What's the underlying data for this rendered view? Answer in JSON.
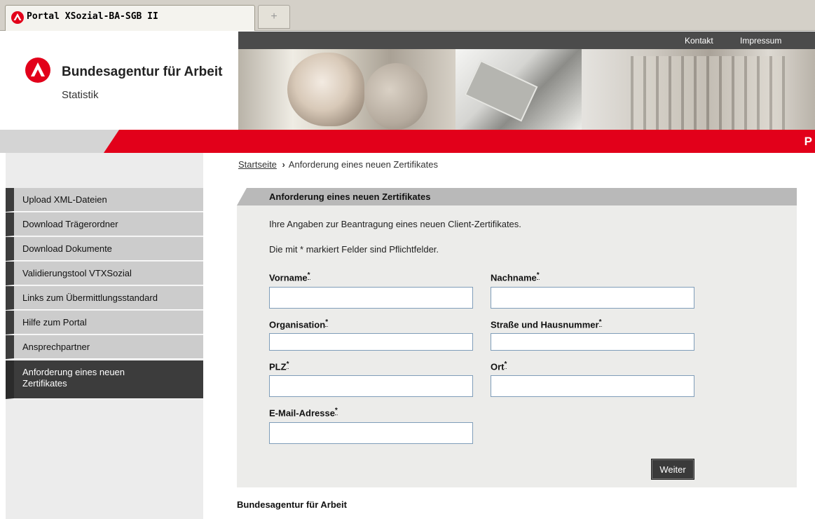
{
  "browser": {
    "tab_title": "Portal XSozial-BA-SGB II",
    "new_tab_symbol": "+"
  },
  "header": {
    "org_name": "Bundesagentur für Arbeit",
    "org_sub": "Statistik",
    "topnav": [
      "Kontakt",
      "Impressum"
    ],
    "redband_letter": "P"
  },
  "sidebar": {
    "items": [
      {
        "label": "Upload XML-Dateien"
      },
      {
        "label": "Download Trägerordner"
      },
      {
        "label": "Download Dokumente"
      },
      {
        "label": "Validierungstool VTXSozial"
      },
      {
        "label": "Links zum Übermittlungsstandard"
      },
      {
        "label": "Hilfe zum Portal"
      },
      {
        "label": "Ansprechpartner"
      },
      {
        "label": "Anforderung eines neuen Zertifikates",
        "active": true
      }
    ]
  },
  "breadcrumb": {
    "home": "Startseite",
    "separator": "›",
    "current": "Anforderung eines neuen Zertifikates"
  },
  "form": {
    "title": "Anforderung eines neuen Zertifikates",
    "intro": "Ihre Angaben zur Beantragung eines neuen Client-Zertifikates.",
    "required_note": "Die mit * markiert Felder sind Pflichtfelder.",
    "required_marker": "*",
    "fields": {
      "vorname": {
        "label": "Vorname",
        "value": ""
      },
      "nachname": {
        "label": "Nachname",
        "value": ""
      },
      "organisation": {
        "label": "Organisation",
        "value": ""
      },
      "strasse": {
        "label": "Straße und Hausnummer",
        "value": ""
      },
      "plz": {
        "label": "PLZ",
        "value": ""
      },
      "ort": {
        "label": "Ort",
        "value": ""
      },
      "email": {
        "label": "E-Mail-Adresse",
        "value": ""
      }
    },
    "submit_label": "Weiter"
  },
  "footer": {
    "text": "Bundesagentur für Arbeit"
  },
  "colors": {
    "brand_red": "#e2001a",
    "nav_dark": "#3c3c3c",
    "panel_bg": "#ececea"
  }
}
